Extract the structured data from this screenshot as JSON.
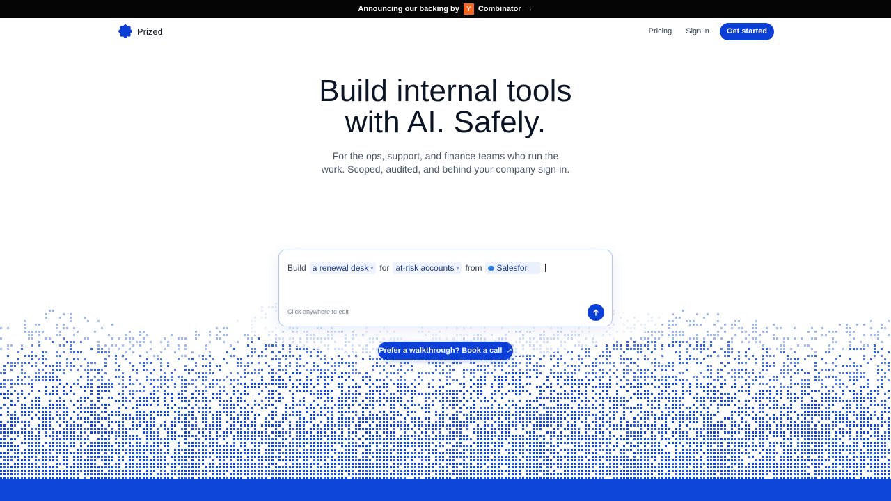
{
  "announcement": {
    "text": "Announcing our backing by",
    "badge": "Y",
    "partner": "Combinator",
    "arrow": "→"
  },
  "nav": {
    "brand": "Prized",
    "links": [
      "Pricing",
      "Sign in"
    ],
    "cta": "Get started"
  },
  "hero": {
    "title_line1": "Build internal tools",
    "title_line2": "with AI. Safely.",
    "subtitle_line1": "For the ops, support, and finance teams who run the",
    "subtitle_line2": "work. Scoped, audited, and behind your company sign-in."
  },
  "prompt": {
    "word_build": "Build",
    "chip_tool": "a renewal desk",
    "word_for": "for",
    "chip_audience": "at-risk accounts",
    "word_from": "from",
    "chip_source": "Salesfor",
    "hint": "Click anywhere to edit"
  },
  "walkthrough": {
    "label": "Prefer a walkthrough? Book a call",
    "icon": "↗"
  },
  "colors": {
    "brand_blue": "#0b3fd6",
    "announce_bg": "#050505",
    "yc_orange": "#f26522"
  }
}
